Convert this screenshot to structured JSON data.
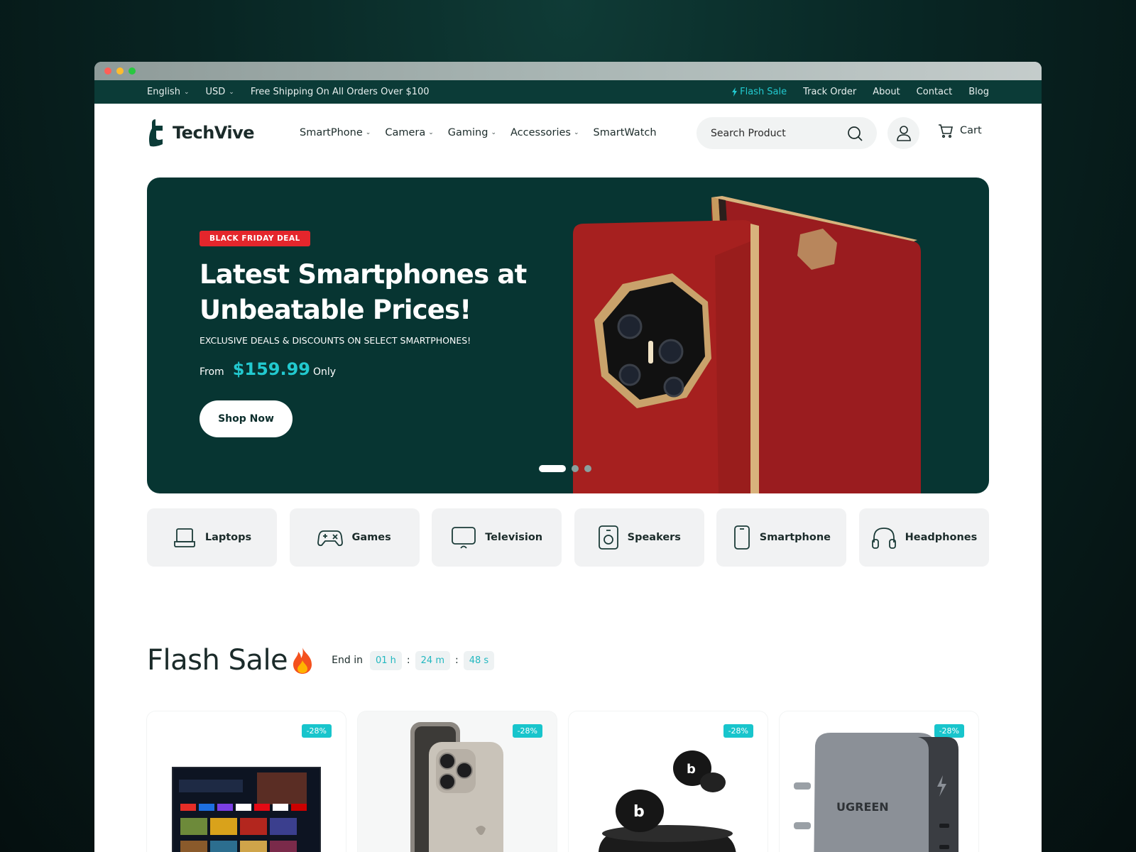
{
  "topbar": {
    "language": "English",
    "currency": "USD",
    "shipping_notice": "Free Shipping On All Orders Over $100",
    "links": [
      "Flash Sale",
      "Track Order",
      "About",
      "Contact",
      "Blog"
    ]
  },
  "brand": {
    "name": "TechVive"
  },
  "nav": {
    "items": [
      {
        "label": "SmartPhone",
        "has_dropdown": true
      },
      {
        "label": "Camera",
        "has_dropdown": true
      },
      {
        "label": "Gaming",
        "has_dropdown": true
      },
      {
        "label": "Accessories",
        "has_dropdown": true
      },
      {
        "label": "SmartWatch",
        "has_dropdown": false
      }
    ],
    "search_placeholder": "Search Product",
    "cart_label": "Cart"
  },
  "hero": {
    "badge": "BLACK FRIDAY DEAL",
    "title": "Latest Smartphones at Unbeatable Prices!",
    "subtitle": "EXCLUSIVE DEALS & DISCOUNTS ON SELECT SMARTPHONES!",
    "price_prefix": "From",
    "price": "$159.99",
    "price_suffix": "Only",
    "cta": "Shop Now",
    "slides": 3,
    "active_slide": 1
  },
  "categories": [
    {
      "label": "Laptops",
      "icon": "laptop-icon"
    },
    {
      "label": "Games",
      "icon": "gamepad-icon"
    },
    {
      "label": "Television",
      "icon": "television-icon"
    },
    {
      "label": "Speakers",
      "icon": "speaker-icon"
    },
    {
      "label": "Smartphone",
      "icon": "smartphone-icon"
    },
    {
      "label": "Headphones",
      "icon": "headphones-icon"
    }
  ],
  "flash_sale": {
    "title": "Flash Sale",
    "ends_label": "End in",
    "hours": "01 h",
    "minutes": "24 m",
    "seconds": "48 s",
    "products": [
      {
        "discount": "-28%",
        "image": "smart-tv"
      },
      {
        "discount": "-28%",
        "image": "iphone"
      },
      {
        "discount": "-28%",
        "image": "earbuds"
      },
      {
        "discount": "-28%",
        "image": "ugreen-charger"
      }
    ]
  },
  "colors": {
    "brand_dark": "#0b3b37",
    "accent": "#22c9cf",
    "badge_red": "#e4262c"
  }
}
